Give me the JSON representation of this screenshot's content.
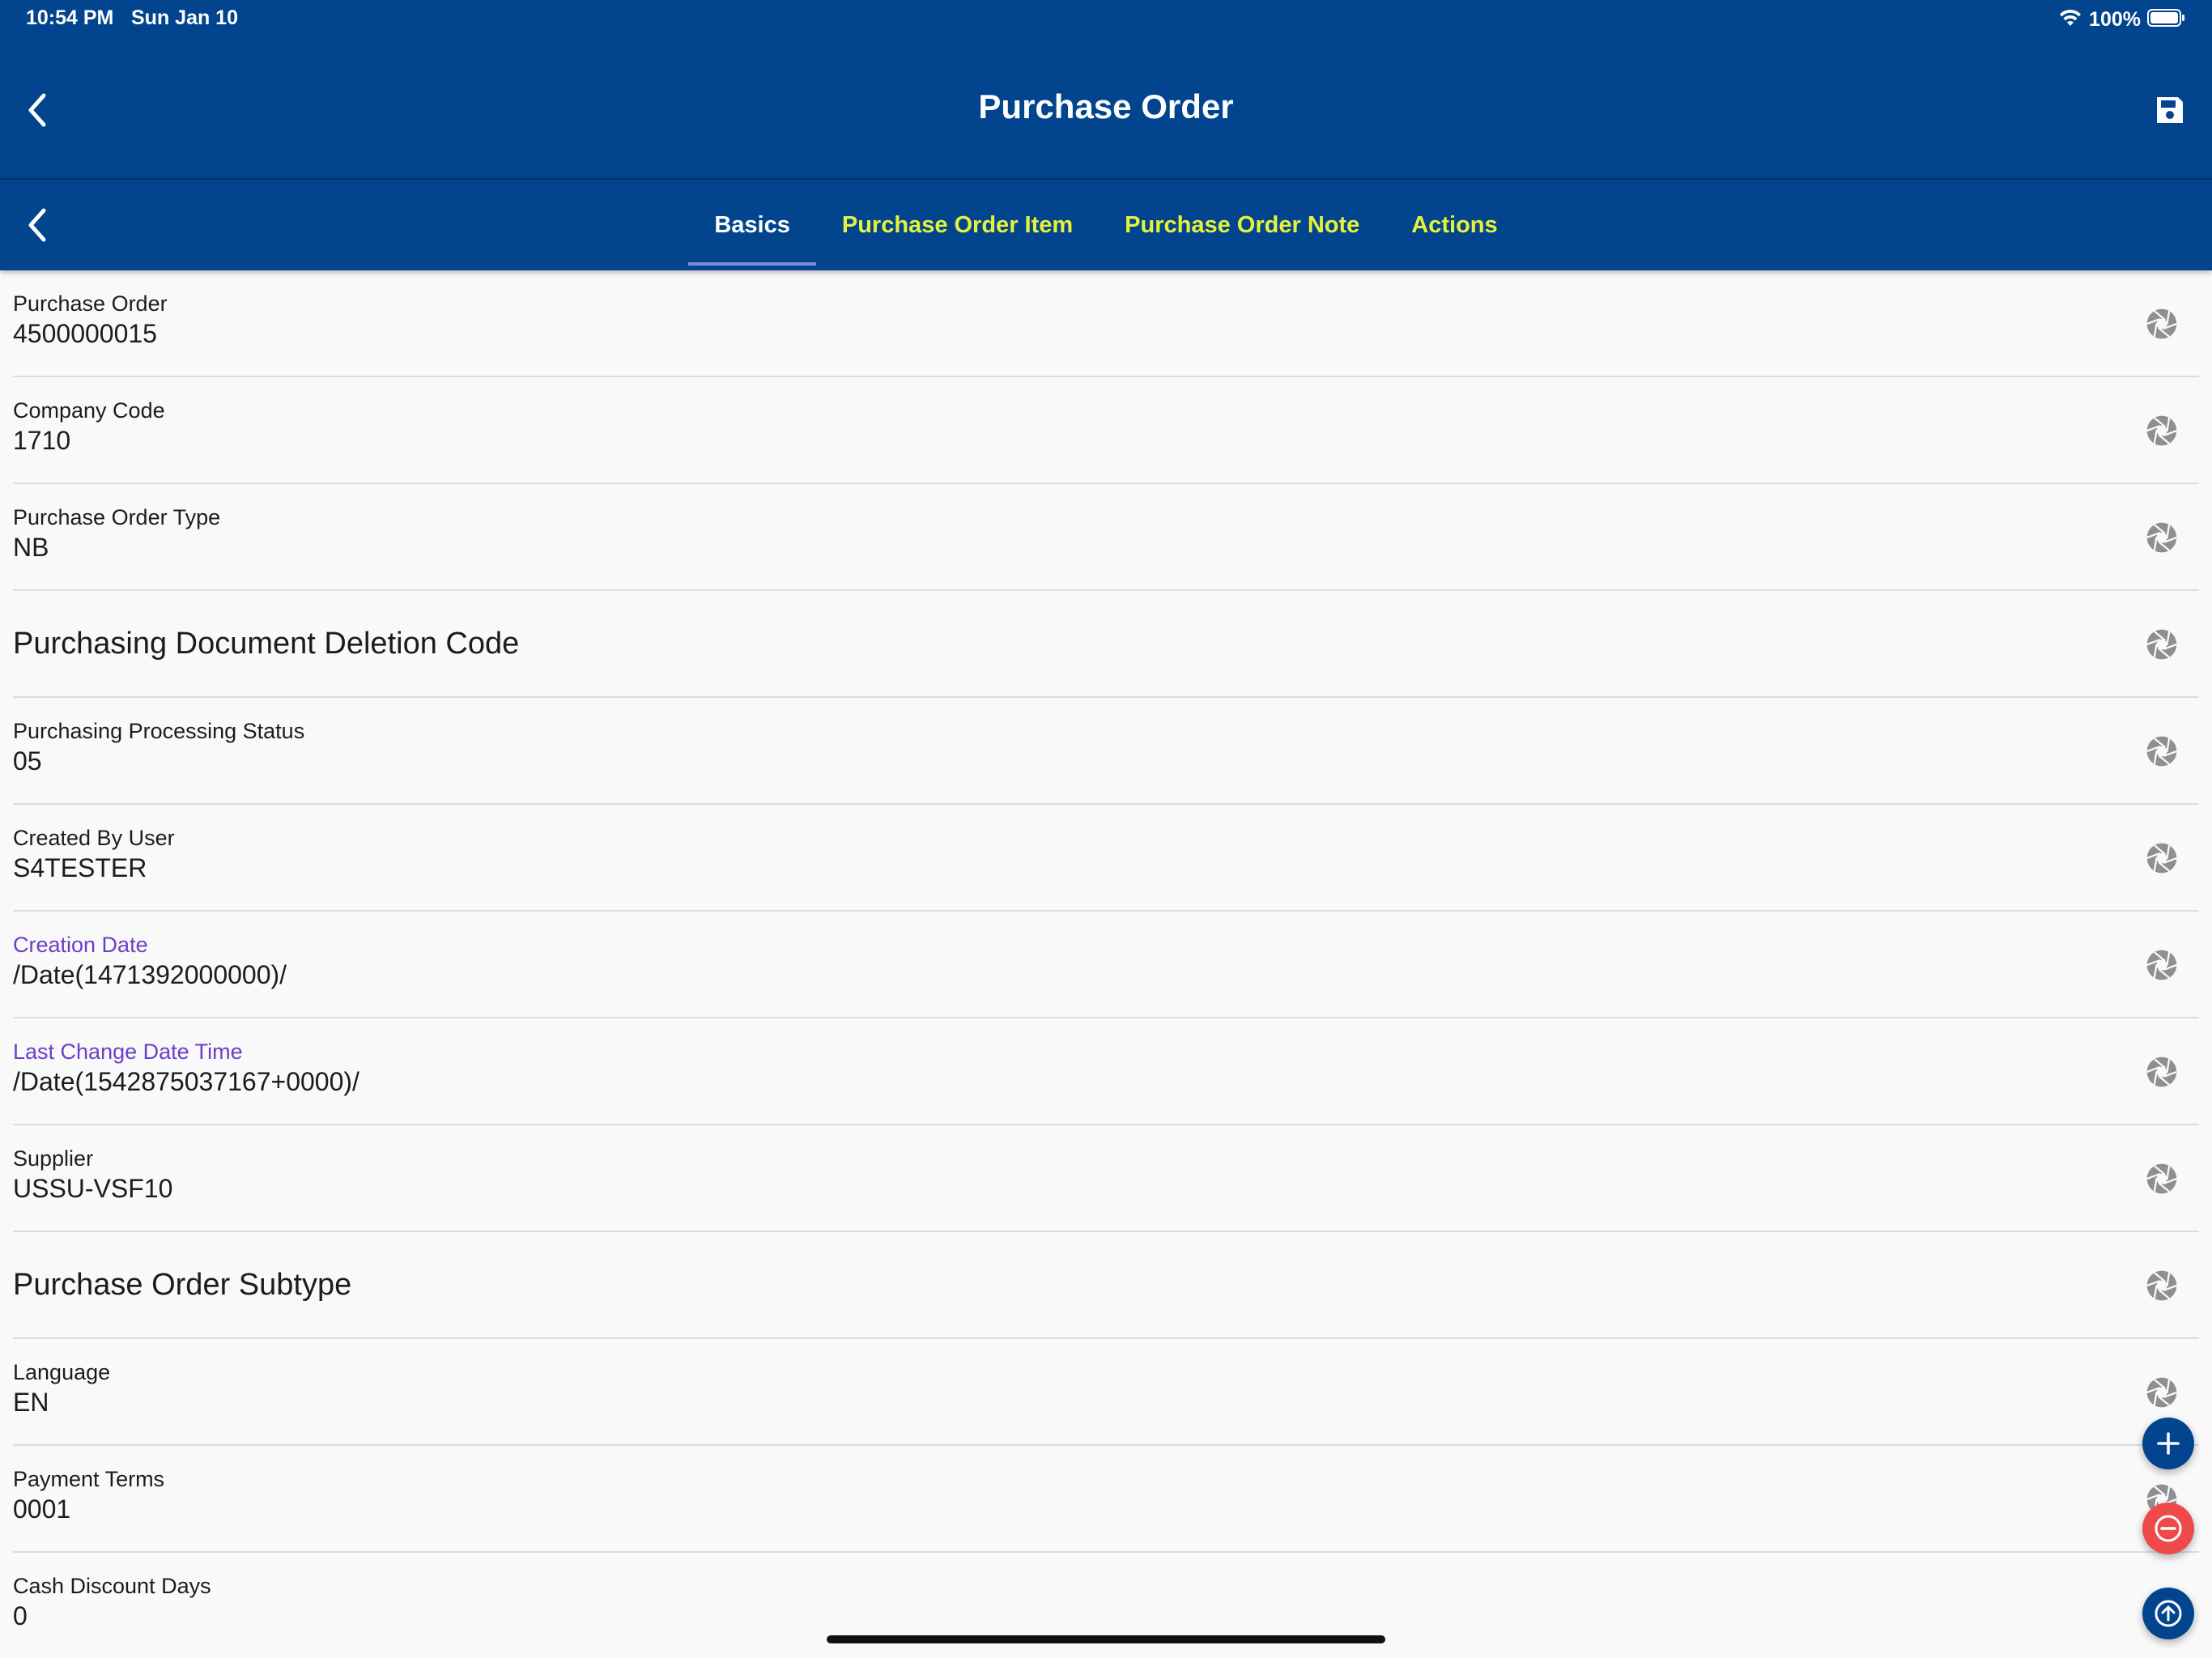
{
  "status_bar": {
    "time": "10:54 PM",
    "date": "Sun Jan 10",
    "battery": "100%"
  },
  "header": {
    "title": "Purchase Order"
  },
  "tabs": [
    {
      "label": "Basics",
      "active": true
    },
    {
      "label": "Purchase Order Item",
      "active": false
    },
    {
      "label": "Purchase Order Note",
      "active": false
    },
    {
      "label": "Actions",
      "active": false
    }
  ],
  "fields": [
    {
      "label": "Purchase Order",
      "value": "4500000015"
    },
    {
      "label": "Company Code",
      "value": "1710"
    },
    {
      "label": "Purchase Order Type",
      "value": "NB"
    },
    {
      "heading": "Purchasing Document Deletion Code"
    },
    {
      "label": "Purchasing Processing Status",
      "value": "05"
    },
    {
      "label": "Created By User",
      "value": "S4TESTER"
    },
    {
      "label": "Creation Date",
      "value": "/Date(1471392000000)/"
    },
    {
      "label": "Last Change Date Time",
      "value": "/Date(1542875037167+0000)/"
    },
    {
      "label": "Supplier",
      "value": "USSU-VSF10"
    },
    {
      "heading": "Purchase Order Subtype"
    },
    {
      "label": "Language",
      "value": "EN"
    },
    {
      "label": "Payment Terms",
      "value": "0001"
    },
    {
      "label": "Cash Discount Days",
      "value": "0"
    }
  ],
  "icons": {
    "row_action": "aperture-icon",
    "back": "chevron-left-icon",
    "save": "save-icon",
    "wifi": "wifi-icon",
    "battery": "battery-icon",
    "add": "plus-icon",
    "remove": "minus-circle-icon",
    "scroll_up": "arrow-up-circle-icon"
  },
  "colors": {
    "header_bg": "#02458e",
    "tab_inactive": "#e6f23a",
    "tab_active": "#ffffff",
    "accent_label": "#6d3fc8",
    "remove_button": "#f0494b"
  }
}
